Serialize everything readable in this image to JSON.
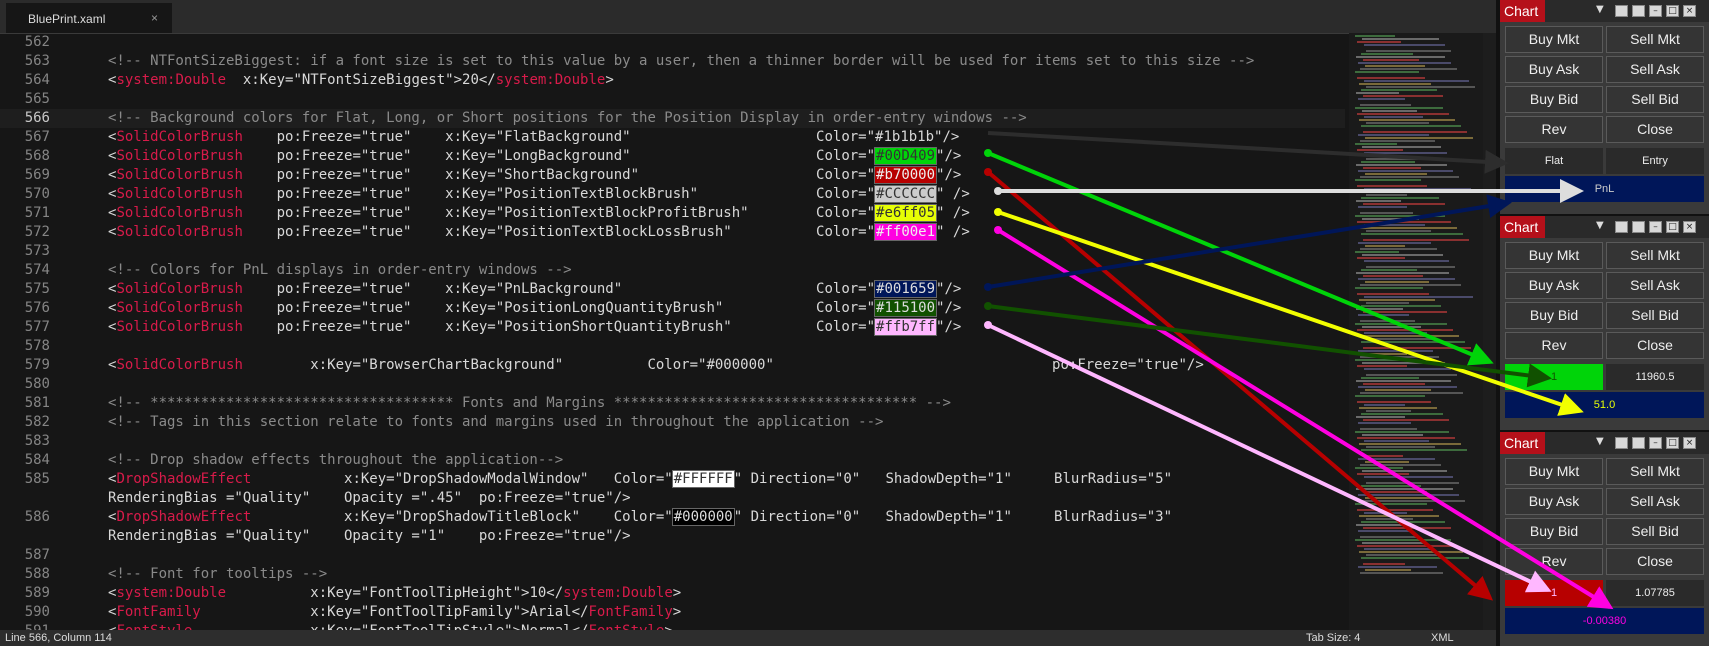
{
  "editor": {
    "tab_title": "BluePrint.xaml",
    "tab_close": "×",
    "status": {
      "position": "Line 566, Column 114",
      "tab_size": "Tab Size: 4",
      "syntax": "XML"
    },
    "lines": [
      {
        "num": "562",
        "segs": []
      },
      {
        "num": "563",
        "segs": [
          {
            "t": "<!-- NTFontSizeBiggest: if a font size is set to this value by a user, then a thinner border will be used for items set to this size -->",
            "c": "cm"
          }
        ]
      },
      {
        "num": "564",
        "segs": [
          {
            "t": "<",
            "c": "st"
          },
          {
            "t": "system:Double",
            "c": "tg"
          },
          {
            "t": "  x:Key=\"NTFontSizeBiggest\">20</",
            "c": "st"
          },
          {
            "t": "system:Double",
            "c": "tg"
          },
          {
            "t": ">",
            "c": "st"
          }
        ]
      },
      {
        "num": "565",
        "segs": []
      },
      {
        "num": "566",
        "segs": [
          {
            "t": "<!-- Background colors for Flat, Long, or Short positions for the Position Display in order-entry windows -->",
            "c": "cm"
          }
        ]
      },
      {
        "num": "567",
        "segs": [
          {
            "t": "<",
            "c": "st"
          },
          {
            "t": "SolidColorBrush",
            "c": "tg"
          },
          {
            "t": "    po:Freeze=\"true\"    x:Key=\"FlatBackground\"                      Color=\"",
            "c": "st"
          },
          {
            "t": "#1b1b1b",
            "c": "st"
          },
          {
            "t": "\"/>",
            "c": "st"
          }
        ]
      },
      {
        "num": "568",
        "segs": [
          {
            "t": "<",
            "c": "st"
          },
          {
            "t": "SolidColorBrush",
            "c": "tg"
          },
          {
            "t": "    po:Freeze=\"true\"    x:Key=\"LongBackground\"                      Color=\"",
            "c": "st"
          },
          {
            "t": "#00D409",
            "c": "st",
            "bg": "#00d409",
            "fg": "#333"
          },
          {
            "t": "\"/>",
            "c": "st"
          }
        ]
      },
      {
        "num": "569",
        "segs": [
          {
            "t": "<",
            "c": "st"
          },
          {
            "t": "SolidColorBrush",
            "c": "tg"
          },
          {
            "t": "    po:Freeze=\"true\"    x:Key=\"ShortBackground\"                     Color=\"",
            "c": "st"
          },
          {
            "t": "#b70000",
            "c": "st",
            "bg": "#b70000",
            "fg": "#eee"
          },
          {
            "t": "\"/>",
            "c": "st"
          }
        ]
      },
      {
        "num": "570",
        "segs": [
          {
            "t": "<",
            "c": "st"
          },
          {
            "t": "SolidColorBrush",
            "c": "tg"
          },
          {
            "t": "    po:Freeze=\"true\"    x:Key=\"PositionTextBlockBrush\"              Color=\"",
            "c": "st"
          },
          {
            "t": "#CCCCCC",
            "c": "st",
            "bg": "#cccccc",
            "fg": "#333"
          },
          {
            "t": "\" />",
            "c": "st"
          }
        ]
      },
      {
        "num": "571",
        "segs": [
          {
            "t": "<",
            "c": "st"
          },
          {
            "t": "SolidColorBrush",
            "c": "tg"
          },
          {
            "t": "    po:Freeze=\"true\"    x:Key=\"PositionTextBlockProfitBrush\"        Color=\"",
            "c": "st"
          },
          {
            "t": "#e6ff05",
            "c": "st",
            "bg": "#e6ff05",
            "fg": "#333"
          },
          {
            "t": "\" />",
            "c": "st"
          }
        ]
      },
      {
        "num": "572",
        "segs": [
          {
            "t": "<",
            "c": "st"
          },
          {
            "t": "SolidColorBrush",
            "c": "tg"
          },
          {
            "t": "    po:Freeze=\"true\"    x:Key=\"PositionTextBlockLossBrush\"          Color=\"",
            "c": "st"
          },
          {
            "t": "#ff00e1",
            "c": "st",
            "bg": "#ff00e1",
            "fg": "#eee"
          },
          {
            "t": "\" />",
            "c": "st"
          }
        ]
      },
      {
        "num": "573",
        "segs": []
      },
      {
        "num": "574",
        "segs": [
          {
            "t": "<!-- Colors for PnL displays in order-entry windows -->",
            "c": "cm"
          }
        ]
      },
      {
        "num": "575",
        "segs": [
          {
            "t": "<",
            "c": "st"
          },
          {
            "t": "SolidColorBrush",
            "c": "tg"
          },
          {
            "t": "    po:Freeze=\"true\"    x:Key=\"PnLBackground\"                       Color=\"",
            "c": "st"
          },
          {
            "t": "#001659",
            "c": "st",
            "bg": "#001659",
            "fg": "#ddd"
          },
          {
            "t": "\"/>",
            "c": "st"
          }
        ]
      },
      {
        "num": "576",
        "segs": [
          {
            "t": "<",
            "c": "st"
          },
          {
            "t": "SolidColorBrush",
            "c": "tg"
          },
          {
            "t": "    po:Freeze=\"true\"    x:Key=\"PositionLongQuantityBrush\"           Color=\"",
            "c": "st"
          },
          {
            "t": "#115100",
            "c": "st",
            "bg": "#115100",
            "fg": "#ddd"
          },
          {
            "t": "\"/>",
            "c": "st"
          }
        ]
      },
      {
        "num": "577",
        "segs": [
          {
            "t": "<",
            "c": "st"
          },
          {
            "t": "SolidColorBrush",
            "c": "tg"
          },
          {
            "t": "    po:Freeze=\"true\"    x:Key=\"PositionShortQuantityBrush\"          Color=\"",
            "c": "st"
          },
          {
            "t": "#ffb7ff",
            "c": "st",
            "bg": "#ffb7ff",
            "fg": "#333"
          },
          {
            "t": "\"/>",
            "c": "st"
          }
        ]
      },
      {
        "num": "578",
        "segs": []
      },
      {
        "num": "579",
        "segs": [
          {
            "t": "<",
            "c": "st"
          },
          {
            "t": "SolidColorBrush",
            "c": "tg"
          },
          {
            "t": "        x:Key=\"BrowserChartBackground\"          Color=\"#000000\"                                 po:Freeze=\"true\"/>",
            "c": "st"
          }
        ]
      },
      {
        "num": "580",
        "segs": []
      },
      {
        "num": "581",
        "segs": [
          {
            "t": "<!-- ************************************ Fonts and Margins ************************************ -->",
            "c": "cm"
          }
        ]
      },
      {
        "num": "582",
        "segs": [
          {
            "t": "<!-- Tags in this section relate to fonts and margins used in throughout the application -->",
            "c": "cm"
          }
        ]
      },
      {
        "num": "583",
        "segs": []
      },
      {
        "num": "584",
        "segs": [
          {
            "t": "<!-- Drop shadow effects throughout the application-->",
            "c": "cm"
          }
        ]
      },
      {
        "num": "585",
        "segs": [
          {
            "t": "<",
            "c": "st"
          },
          {
            "t": "DropShadowEffect",
            "c": "tg"
          },
          {
            "t": "           x:Key=\"DropShadowModalWindow\"   Color=\"",
            "c": "st"
          },
          {
            "t": "#FFFFFF",
            "c": "st",
            "bg": "#ffffff",
            "fg": "#333"
          },
          {
            "t": "\" Direction=\"0\"   ShadowDepth=\"1\"     BlurRadius=\"5\"",
            "c": "st"
          }
        ]
      },
      {
        "num": "",
        "segs": [
          {
            "t": "RenderingBias =\"Quality\"    Opacity =\".45\"  po:Freeze=\"true\"/>",
            "c": "st"
          }
        ]
      },
      {
        "num": "586",
        "segs": [
          {
            "t": "<",
            "c": "st"
          },
          {
            "t": "DropShadowEffect",
            "c": "tg"
          },
          {
            "t": "           x:Key=\"DropShadowTitleBlock\"    Color=\"",
            "c": "st"
          },
          {
            "t": "#000000",
            "c": "st",
            "bg": "#000000",
            "fg": "#ddd"
          },
          {
            "t": "\" Direction=\"0\"   ShadowDepth=\"1\"     BlurRadius=\"3\"",
            "c": "st"
          }
        ]
      },
      {
        "num": "",
        "segs": [
          {
            "t": "RenderingBias =\"Quality\"    Opacity =\"1\"    po:Freeze=\"true\"/>",
            "c": "st"
          }
        ]
      },
      {
        "num": "587",
        "segs": []
      },
      {
        "num": "588",
        "segs": [
          {
            "t": "<!-- Font for tooltips -->",
            "c": "cm"
          }
        ]
      },
      {
        "num": "589",
        "segs": [
          {
            "t": "<",
            "c": "st"
          },
          {
            "t": "system:Double",
            "c": "tg"
          },
          {
            "t": "          x:Key=\"FontToolTipHeight\">10</",
            "c": "st"
          },
          {
            "t": "system:Double",
            "c": "tg"
          },
          {
            "t": ">",
            "c": "st"
          }
        ]
      },
      {
        "num": "590",
        "segs": [
          {
            "t": "<",
            "c": "st"
          },
          {
            "t": "FontFamily",
            "c": "tg"
          },
          {
            "t": "             x:Key=\"FontToolTipFamily\">Arial</",
            "c": "st"
          },
          {
            "t": "FontFamily",
            "c": "tg"
          },
          {
            "t": ">",
            "c": "st"
          }
        ]
      },
      {
        "num": "591",
        "segs": [
          {
            "t": "<",
            "c": "st"
          },
          {
            "t": "FontStyle",
            "c": "tg"
          },
          {
            "t": "              x:Key=\"FontToolTipStyle\">Normal</",
            "c": "st"
          },
          {
            "t": "FontStyle",
            "c": "tg"
          },
          {
            "t": ">",
            "c": "st"
          }
        ]
      }
    ]
  },
  "panels": [
    {
      "title": "Chart",
      "buttons": [
        "Buy Mkt",
        "Sell Mkt",
        "Buy Ask",
        "Sell Ask",
        "Buy Bid",
        "Sell Bid",
        "Rev",
        "Close"
      ],
      "row1": {
        "left": "Flat",
        "right": "Entry"
      },
      "row2": {
        "text": "PnL"
      }
    },
    {
      "title": "Chart",
      "buttons": [
        "Buy Mkt",
        "Sell Mkt",
        "Buy Ask",
        "Sell Ask",
        "Buy Bid",
        "Sell Bid",
        "Rev",
        "Close"
      ],
      "row1": {
        "left": "1",
        "right": "11960.5"
      },
      "row2": {
        "text": "51.0"
      }
    },
    {
      "title": "Chart",
      "buttons": [
        "Buy Mkt",
        "Sell Mkt",
        "Buy Ask",
        "Sell Ask",
        "Buy Bid",
        "Sell Bid",
        "Rev",
        "Close"
      ],
      "row1": {
        "left": "1",
        "right": "1.07785"
      },
      "row2": {
        "text": "-0.00380"
      }
    }
  ],
  "colors": {
    "flat": "#1b1b1b",
    "long": "#00d409",
    "short": "#b70000",
    "text": "#cccccc",
    "profit": "#e6ff05",
    "loss": "#ff00e1",
    "pnl_bg": "#001659",
    "long_qty": "#115100",
    "short_qty": "#ffb7ff",
    "title_red": "#b5101a"
  },
  "icons": [
    "close-icon",
    "dropdown-icon",
    "minimize-icon",
    "maximize-icon",
    "close-window-icon"
  ]
}
